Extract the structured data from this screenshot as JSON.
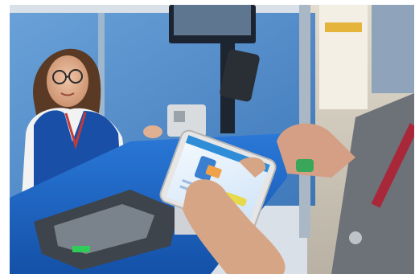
{
  "image": {
    "subject": "cashier-counter-phone-payment",
    "palette": {
      "counter_blue": "#1f6fd1",
      "glass_blue": "#4a86c6",
      "vest_blue": "#1a4fa8",
      "skin": "#e2b497",
      "shirt_white": "#f2f2f2",
      "floor": "#cfc9bd",
      "phone_screen": "#e8f2fb",
      "accent_yellow": "#e6d94a"
    },
    "phone_screen": {
      "icon": "mobile-payment-icon",
      "texts": []
    }
  }
}
